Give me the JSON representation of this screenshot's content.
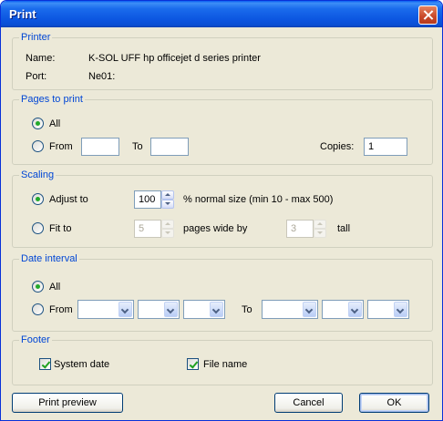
{
  "window": {
    "title": "Print"
  },
  "printer": {
    "legend": "Printer",
    "name_label": "Name:",
    "name_value": "K-SOL UFF hp officejet d series printer",
    "port_label": "Port:",
    "port_value": "Ne01:"
  },
  "pages": {
    "legend": "Pages to print",
    "all_label": "All",
    "from_label": "From",
    "to_label": "To",
    "from_value": "",
    "to_value": "",
    "copies_label": "Copies:",
    "copies_value": "1",
    "selected": "All"
  },
  "scaling": {
    "legend": "Scaling",
    "adjust_label": "Adjust to",
    "adjust_value": "100",
    "adjust_suffix": "% normal size (min 10 - max 500)",
    "fit_label": "Fit to",
    "wide_value": "5",
    "wide_suffix": "pages wide by",
    "tall_value": "3",
    "tall_suffix": "tall",
    "selected": "Adjust to"
  },
  "date_interval": {
    "legend": "Date interval",
    "all_label": "All",
    "from_label": "From",
    "to_label": "To",
    "selected": "All"
  },
  "footer": {
    "legend": "Footer",
    "system_date_label": "System date",
    "system_date_checked": true,
    "file_name_label": "File name",
    "file_name_checked": true
  },
  "buttons": {
    "preview": "Print preview",
    "cancel": "Cancel",
    "ok": "OK"
  },
  "colors": {
    "title_bar": "#0A5FF2",
    "group_legend": "#0046D5",
    "dialog_bg": "#ECE9D8",
    "close_button": "#C8482A"
  }
}
